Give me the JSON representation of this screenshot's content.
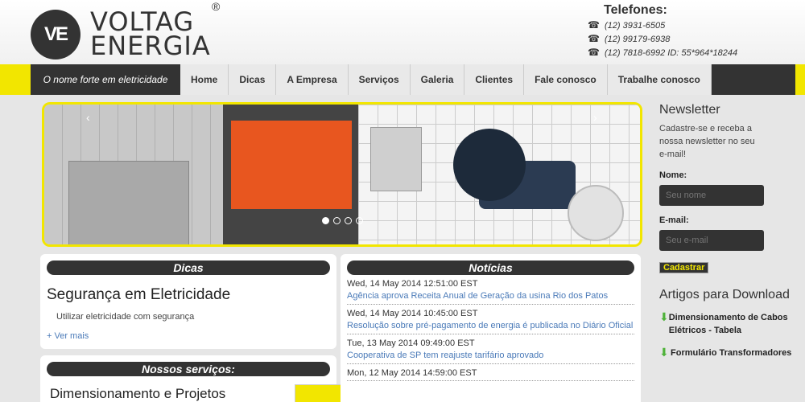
{
  "header": {
    "logo_text": "VE",
    "brand_line1": "VOLTAG",
    "brand_line2": "ENERGIA",
    "registered": "®",
    "phones_title": "Telefones:",
    "phones": [
      "(12) 3931-6505",
      "(12) 99179-6938",
      "(12) 7818-6992 ID: 55*964*18244"
    ]
  },
  "nav": {
    "slogan": "O nome forte em eletricidade",
    "items": [
      "Home",
      "Dicas",
      "A Empresa",
      "Serviços",
      "Galeria",
      "Clientes",
      "Fale conosco",
      "Trabalhe conosco"
    ]
  },
  "slider": {
    "prev": "‹",
    "next": "›",
    "slides": 4,
    "active_slide": 1
  },
  "dicas": {
    "title": "Dicas",
    "heading": "Segurança em Eletricidade",
    "text": "Utilizar eletricidade com segurança",
    "more": "+ Ver mais"
  },
  "servicos": {
    "title": "Nossos serviços:",
    "heading": "Dimensionamento e Projetos"
  },
  "noticias": {
    "title": "Notícias",
    "items": [
      {
        "date": "Wed, 14 May 2014 12:51:00 EST",
        "text": "Agência aprova Receita Anual de Geração da usina Rio dos Patos"
      },
      {
        "date": "Wed, 14 May 2014 10:45:00 EST",
        "text": "Resolução sobre pré-pagamento de energia é publicada no Diário Oficial"
      },
      {
        "date": "Tue, 13 May 2014 09:49:00 EST",
        "text": "Cooperativa de SP tem reajuste tarifário aprovado"
      },
      {
        "date": "Mon, 12 May 2014 14:59:00 EST",
        "text": ""
      }
    ]
  },
  "newsletter": {
    "title": "Newsletter",
    "desc": "Cadastre-se e receba a nossa newsletter no seu e-mail!",
    "name_label": "Nome:",
    "name_placeholder": "Seu nome",
    "email_label": "E-mail:",
    "email_placeholder": "Seu e-mail",
    "submit": "Cadastrar"
  },
  "downloads": {
    "title": "Artigos para Download",
    "items": [
      "Dimensionamento de Cabos Elétricos - Tabela",
      "Formulário Transformadores"
    ]
  },
  "colors": {
    "accent": "#f2e600",
    "dark": "#333333",
    "link": "#4a7ab8"
  }
}
